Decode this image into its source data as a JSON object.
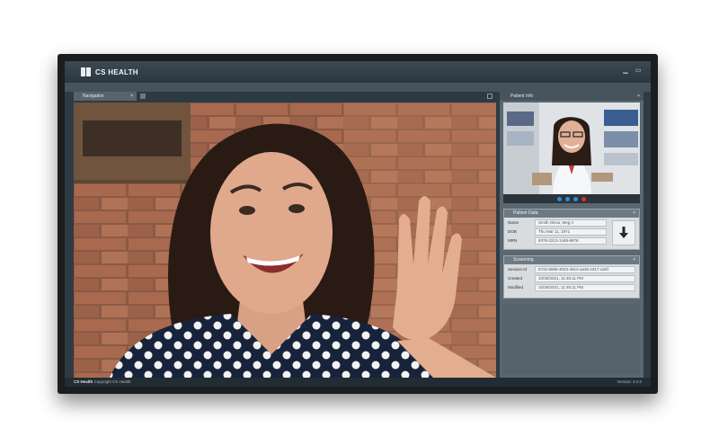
{
  "app": {
    "title": "CS HEALTH"
  },
  "navigation_panel": {
    "tab_label": "Navigation",
    "close": "×"
  },
  "patient_info": {
    "header": "Patient Info",
    "close": "×",
    "call_controls": [
      "camera",
      "mic",
      "share",
      "end-call"
    ]
  },
  "patient_data": {
    "header": "Patient Data",
    "fields": [
      {
        "label": "Name",
        "value": "Smith Olivia, Meg A"
      },
      {
        "label": "DOB",
        "value": "Thu Mar 11, 1971"
      },
      {
        "label": "MRN",
        "value": "8378-2213-1448-8876"
      }
    ]
  },
  "screening": {
    "header": "Screening",
    "fields": [
      {
        "label": "Session Id",
        "value": "8732-8896-3023-4612-aa36-1817-a28f"
      },
      {
        "label": "Created",
        "value": "10/30/2021, 11:46:11 PM"
      },
      {
        "label": "Modified",
        "value": "10/30/2021, 11:46:11 PM"
      }
    ]
  },
  "statusbar": {
    "app": "CS Health",
    "copyright": "Copyright CS Health",
    "version": "Version: 3.0.0"
  },
  "colors": {
    "screen_bg": "#2e3b45",
    "panel_bg": "#5a6770",
    "end_call": "#d9322f",
    "call_btn": "#2e8fd6"
  }
}
